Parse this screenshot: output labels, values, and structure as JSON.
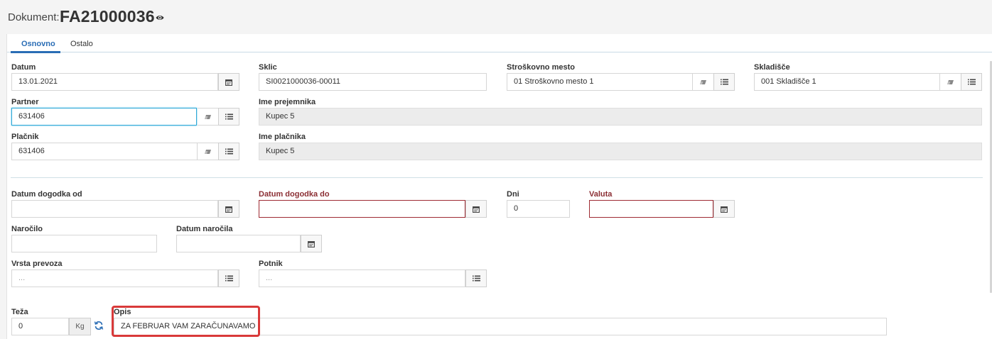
{
  "header": {
    "prefix": "Dokument:",
    "doc_number": "FA21000036"
  },
  "tabs": [
    {
      "label": "Osnovno",
      "active": true
    },
    {
      "label": "Ostalo",
      "active": false
    }
  ],
  "fields": {
    "datum": {
      "label": "Datum",
      "value": "13.01.2021"
    },
    "sklic": {
      "label": "Sklic",
      "value": "SI0021000036-00011"
    },
    "strosek": {
      "label": "Stroškovno mesto",
      "value": "01 Stroškovno mesto 1"
    },
    "skladisce": {
      "label": "Skladišče",
      "value": "001 Skladišče 1"
    },
    "partner": {
      "label": "Partner",
      "value": "631406"
    },
    "ime_prejemnika": {
      "label": "Ime prejemnika",
      "value": "Kupec 5"
    },
    "placnik": {
      "label": "Plačnik",
      "value": "631406"
    },
    "ime_placnika": {
      "label": "Ime plačnika",
      "value": "Kupec 5"
    },
    "datum_od": {
      "label": "Datum dogodka od",
      "value": ""
    },
    "datum_do": {
      "label": "Datum dogodka do",
      "value": ""
    },
    "dni": {
      "label": "Dni",
      "value": "0"
    },
    "valuta": {
      "label": "Valuta",
      "value": ""
    },
    "narocilo": {
      "label": "Naročilo",
      "value": ""
    },
    "datum_narocila": {
      "label": "Datum naročila",
      "value": ""
    },
    "vrsta_prevoza": {
      "label": "Vrsta prevoza",
      "placeholder": "..."
    },
    "potnik": {
      "label": "Potnik",
      "placeholder": "..."
    },
    "teza": {
      "label": "Teža",
      "value": "0",
      "unit": "Kg"
    },
    "opis": {
      "label": "Opis",
      "value": "ZA FEBRUAR VAM ZARAČUNAVAMO"
    }
  },
  "colors": {
    "accent": "#2a6db5",
    "required_label": "#8b2e33",
    "highlight_box": "#d93a3a",
    "focus_border": "#2fa8d6"
  },
  "icons": [
    "eye-icon",
    "calendar-icon",
    "eraser-icon",
    "list-icon",
    "refresh-icon"
  ]
}
